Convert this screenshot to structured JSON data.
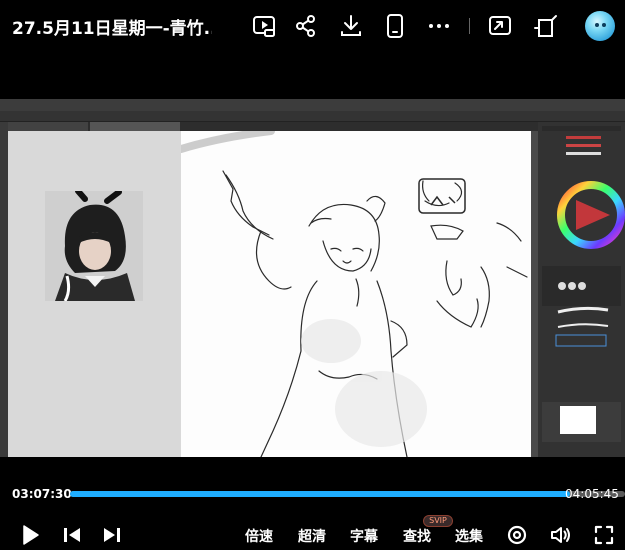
{
  "header": {
    "title": "27.5月11日星期一-青竹...",
    "icons": [
      "picture-in-picture-icon",
      "share-icon",
      "download-icon",
      "phone-icon",
      "more-icon",
      "cast-icon",
      "rotate-icon",
      "avatar"
    ]
  },
  "player": {
    "current_time": "03:07:30",
    "total_time": "04:05:45",
    "progress": 0.9,
    "accent_color": "#1faeff"
  },
  "controls": {
    "speed_label": "倍速",
    "quality_label": "超清",
    "subtitle_label": "字幕",
    "search_label": "查找",
    "search_badge": "SVIP",
    "episodes_label": "选集"
  }
}
